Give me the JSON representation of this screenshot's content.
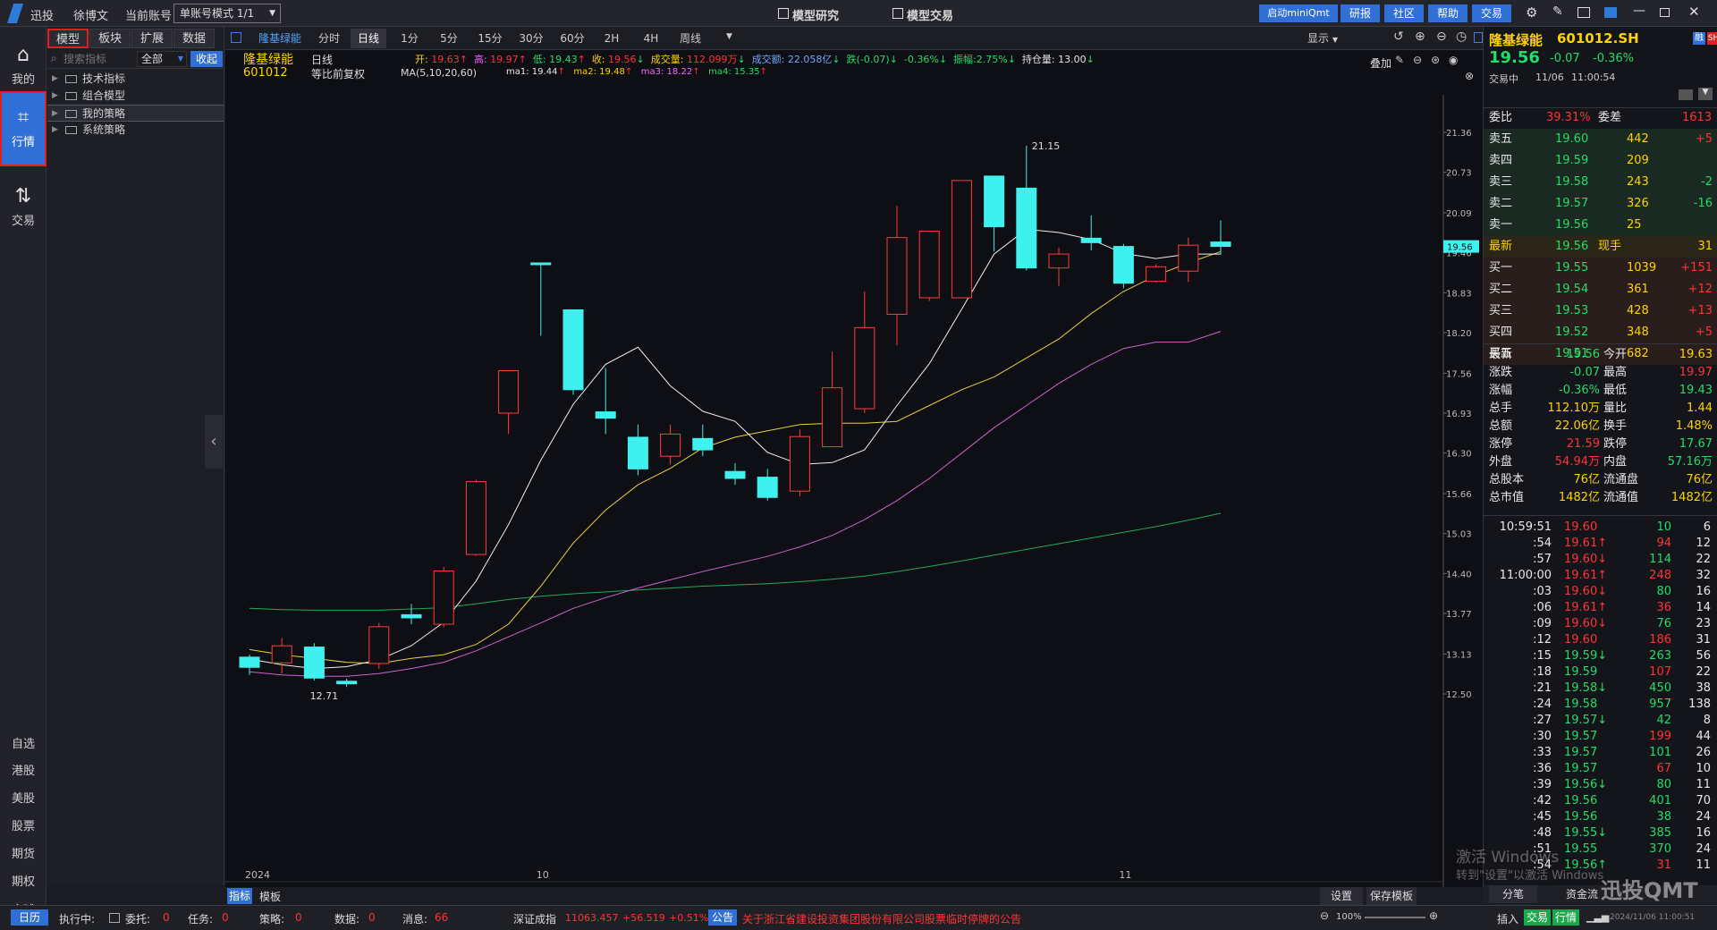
{
  "top": {
    "logo": "迅投",
    "user": "徐博文",
    "account_label": "当前账号",
    "account_mode": "单账号模式 1/1",
    "menu_research": "模型研究",
    "menu_trade": "模型交易",
    "btn_start_mini": "启动miniQmt",
    "btn_report": "研报",
    "btn_community": "社区",
    "btn_help": "帮助",
    "btn_trade": "交易"
  },
  "leftnav": {
    "mine": "我的",
    "quote": "行情",
    "trade": "交易",
    "bottom": [
      "自选",
      "港股",
      "美股",
      "股票",
      "期货",
      "期权",
      "全球"
    ]
  },
  "leftpanel": {
    "tabs": [
      "模型",
      "板块",
      "扩展",
      "数据"
    ],
    "search_placeholder": "搜索指标",
    "filter": "全部",
    "collapse": "收起",
    "tree": [
      "技术指标",
      "组合模型",
      "我的策略",
      "系统策略"
    ]
  },
  "chart_tabs": {
    "stock": "隆基绿能",
    "periods": [
      "分时",
      "日线",
      "1分",
      "5分",
      "15分",
      "30分",
      "60分",
      "2H",
      "4H",
      "周线"
    ],
    "display": "显示"
  },
  "info": {
    "name": "隆基绿能",
    "code": "601012",
    "period": "日线",
    "adjust": "等比前复权",
    "ma_label": "MA(5,10,20,60)",
    "open_l": "开:",
    "open": "19.63",
    "high_l": "高:",
    "high": "19.97",
    "low_l": "低:",
    "low": "19.43",
    "close_l": "收:",
    "close": "19.56",
    "vol_l": "成交量:",
    "vol": "112.099万",
    "amt_l": "成交额:",
    "amt": "22.058亿",
    "chg_l": "跌(-0.07)",
    "chgp": "-0.36%",
    "amp_l": "振幅:",
    "amp": "2.75%",
    "pos_l": "持仓量:",
    "pos": "13.00",
    "ma1_l": "ma1:",
    "ma1": "19.44",
    "ma2_l": "ma2:",
    "ma2": "19.48",
    "ma3_l": "ma3:",
    "ma3": "18.22",
    "ma4_l": "ma4:",
    "ma4": "15.35",
    "overlay": "叠加"
  },
  "chart_data": {
    "type": "candlestick",
    "y_ticks": [
      "21.36",
      "20.73",
      "20.09",
      "19.46",
      "18.83",
      "18.20",
      "17.56",
      "16.93",
      "16.30",
      "15.66",
      "15.03",
      "14.40",
      "13.77",
      "13.13",
      "12.50"
    ],
    "x_ticks": [
      "2024",
      "10",
      "11"
    ],
    "annotations": {
      "high": "21.15",
      "low": "12.71",
      "last_price_tag": "19.56"
    },
    "candles": [
      {
        "o": 13.08,
        "c": 12.92,
        "h": 13.12,
        "l": 12.8
      },
      {
        "o": 12.99,
        "c": 13.26,
        "h": 13.38,
        "l": 12.82
      },
      {
        "o": 13.24,
        "c": 12.75,
        "h": 13.3,
        "l": 12.71
      },
      {
        "o": 12.7,
        "c": 12.66,
        "h": 12.74,
        "l": 12.61
      },
      {
        "o": 12.98,
        "c": 13.56,
        "h": 13.62,
        "l": 12.9
      },
      {
        "o": 13.75,
        "c": 13.7,
        "h": 13.92,
        "l": 13.6
      },
      {
        "o": 13.6,
        "c": 14.44,
        "h": 14.5,
        "l": 13.55
      },
      {
        "o": 14.7,
        "c": 15.85,
        "h": 15.88,
        "l": 14.68
      },
      {
        "o": 16.93,
        "c": 17.6,
        "h": 17.6,
        "l": 16.6
      },
      {
        "o": 19.3,
        "c": 19.28,
        "h": 19.3,
        "l": 18.15
      },
      {
        "o": 18.56,
        "c": 17.3,
        "h": 18.56,
        "l": 17.22
      },
      {
        "o": 16.95,
        "c": 16.85,
        "h": 17.64,
        "l": 16.6
      },
      {
        "o": 16.55,
        "c": 16.05,
        "h": 16.75,
        "l": 15.95
      },
      {
        "o": 16.25,
        "c": 16.6,
        "h": 16.75,
        "l": 16.12
      },
      {
        "o": 16.53,
        "c": 16.35,
        "h": 16.75,
        "l": 16.25
      },
      {
        "o": 16.01,
        "c": 15.9,
        "h": 16.14,
        "l": 15.8
      },
      {
        "o": 15.92,
        "c": 15.6,
        "h": 16.05,
        "l": 15.55
      },
      {
        "o": 15.7,
        "c": 16.56,
        "h": 16.67,
        "l": 15.62
      },
      {
        "o": 16.4,
        "c": 17.33,
        "h": 17.9,
        "l": 16.4
      },
      {
        "o": 17.0,
        "c": 18.28,
        "h": 18.85,
        "l": 16.93
      },
      {
        "o": 18.49,
        "c": 19.7,
        "h": 20.2,
        "l": 18.0
      },
      {
        "o": 18.75,
        "c": 19.8,
        "h": 19.8,
        "l": 18.7
      },
      {
        "o": 18.75,
        "c": 20.6,
        "h": 20.6,
        "l": 18.75
      },
      {
        "o": 20.67,
        "c": 19.87,
        "h": 20.67,
        "l": 19.48
      },
      {
        "o": 20.48,
        "c": 19.22,
        "h": 21.15,
        "l": 19.18
      },
      {
        "o": 19.22,
        "c": 19.44,
        "h": 19.54,
        "l": 18.94
      },
      {
        "o": 19.69,
        "c": 19.62,
        "h": 20.05,
        "l": 19.5
      },
      {
        "o": 19.56,
        "c": 18.98,
        "h": 19.6,
        "l": 18.9
      },
      {
        "o": 19.01,
        "c": 19.24,
        "h": 19.28,
        "l": 18.99
      },
      {
        "o": 19.17,
        "c": 19.58,
        "h": 19.7,
        "l": 19.0
      },
      {
        "o": 19.63,
        "c": 19.56,
        "h": 19.97,
        "l": 19.43
      }
    ],
    "ma1": [
      13.05,
      12.96,
      12.9,
      12.93,
      13.04,
      13.26,
      13.63,
      14.28,
      15.17,
      16.19,
      17.07,
      17.7,
      17.97,
      17.36,
      16.96,
      16.8,
      16.31,
      16.12,
      16.15,
      16.35,
      17.05,
      17.71,
      18.57,
      19.44,
      19.83,
      19.78,
      19.67,
      19.45,
      19.37,
      19.44,
      19.44
    ],
    "ma2": [
      13.2,
      13.12,
      13.06,
      13.0,
      12.98,
      13.06,
      13.12,
      13.28,
      13.6,
      14.2,
      14.88,
      15.4,
      15.8,
      16.06,
      16.38,
      16.55,
      16.65,
      16.75,
      16.77,
      16.77,
      16.8,
      17.05,
      17.3,
      17.5,
      17.8,
      18.1,
      18.5,
      18.85,
      19.1,
      19.3,
      19.48
    ],
    "ma3": [
      12.85,
      12.8,
      12.78,
      12.78,
      12.82,
      12.9,
      13.0,
      13.18,
      13.4,
      13.62,
      13.85,
      14.02,
      14.17,
      14.3,
      14.43,
      14.55,
      14.67,
      14.82,
      15.0,
      15.25,
      15.55,
      15.9,
      16.3,
      16.7,
      17.05,
      17.4,
      17.7,
      17.95,
      18.05,
      18.05,
      18.22
    ],
    "ma4": [
      13.85,
      13.83,
      13.82,
      13.82,
      13.82,
      13.84,
      13.86,
      13.92,
      13.99,
      14.04,
      14.08,
      14.11,
      14.14,
      14.17,
      14.2,
      14.22,
      14.24,
      14.27,
      14.31,
      14.36,
      14.43,
      14.51,
      14.6,
      14.69,
      14.78,
      14.87,
      14.96,
      15.05,
      15.14,
      15.24,
      15.35
    ]
  },
  "right": {
    "name": "隆基绿能",
    "code": "601012.SH",
    "price": "19.56",
    "chg": "-0.07",
    "chgp": "-0.36%",
    "status": "交易中",
    "date": "11/06",
    "time": "11:00:54",
    "wb_l": "委比",
    "wb": "39.31%",
    "wc_l": "委差",
    "wc": "1613",
    "asks": [
      {
        "l": "卖五",
        "p": "19.60",
        "v": "442",
        "d": "+5"
      },
      {
        "l": "卖四",
        "p": "19.59",
        "v": "209",
        "d": ""
      },
      {
        "l": "卖三",
        "p": "19.58",
        "v": "243",
        "d": "-2"
      },
      {
        "l": "卖二",
        "p": "19.57",
        "v": "326",
        "d": "-16"
      },
      {
        "l": "卖一",
        "p": "19.56",
        "v": "25",
        "d": ""
      }
    ],
    "latest": {
      "l": "最新",
      "p": "19.56",
      "v": "现手",
      "d": "31"
    },
    "bids": [
      {
        "l": "买一",
        "p": "19.55",
        "v": "1039",
        "d": "+151"
      },
      {
        "l": "买二",
        "p": "19.54",
        "v": "361",
        "d": "+12"
      },
      {
        "l": "买三",
        "p": "19.53",
        "v": "428",
        "d": "+13"
      },
      {
        "l": "买四",
        "p": "19.52",
        "v": "348",
        "d": "+5"
      },
      {
        "l": "买五",
        "p": "19.51",
        "v": "682",
        "d": ""
      }
    ],
    "stats": [
      [
        "最新",
        "19.56",
        "今开",
        "19.63"
      ],
      [
        "涨跌",
        "-0.07",
        "最高",
        "19.97"
      ],
      [
        "涨幅",
        "-0.36%",
        "最低",
        "19.43"
      ],
      [
        "总手",
        "112.10万",
        "量比",
        "1.44"
      ],
      [
        "总额",
        "22.06亿",
        "换手",
        "1.48%"
      ],
      [
        "涨停",
        "21.59",
        "跌停",
        "17.67"
      ],
      [
        "外盘",
        "54.94万",
        "内盘",
        "57.16万"
      ],
      [
        "总股本",
        "76亿",
        "流通盘",
        "76亿"
      ],
      [
        "总市值",
        "1482亿",
        "流通值",
        "1482亿"
      ]
    ],
    "ticks": [
      [
        "10:59:51",
        "19.60",
        "10",
        "6"
      ],
      [
        ":54",
        "19.61↑",
        "94",
        "12"
      ],
      [
        ":57",
        "19.60↓",
        "114",
        "22"
      ],
      [
        "11:00:00",
        "19.61↑",
        "248",
        "32"
      ],
      [
        ":03",
        "19.60↓",
        "80",
        "16"
      ],
      [
        ":06",
        "19.61↑",
        "36",
        "14"
      ],
      [
        ":09",
        "19.60↓",
        "76",
        "23"
      ],
      [
        ":12",
        "19.60",
        "186",
        "31"
      ],
      [
        ":15",
        "19.59↓",
        "263",
        "56"
      ],
      [
        ":18",
        "19.59",
        "107",
        "22"
      ],
      [
        ":21",
        "19.58↓",
        "450",
        "38"
      ],
      [
        ":24",
        "19.58",
        "957",
        "138"
      ],
      [
        ":27",
        "19.57↓",
        "42",
        "8"
      ],
      [
        ":30",
        "19.57",
        "199",
        "44"
      ],
      [
        ":33",
        "19.57",
        "101",
        "26"
      ],
      [
        ":36",
        "19.57",
        "67",
        "10"
      ],
      [
        ":39",
        "19.56↓",
        "80",
        "11"
      ],
      [
        ":42",
        "19.56",
        "401",
        "70"
      ],
      [
        ":45",
        "19.56",
        "38",
        "24"
      ],
      [
        ":48",
        "19.55↓",
        "385",
        "16"
      ],
      [
        ":51",
        "19.55",
        "370",
        "24"
      ],
      [
        ":54",
        "19.56↑",
        "31",
        "11"
      ]
    ],
    "tabs": [
      "分笔",
      "资金流"
    ]
  },
  "sub": {
    "indicator": "指标",
    "template": "模板",
    "settings": "设置",
    "save_template": "保存模板"
  },
  "status": {
    "calendar": "日历",
    "exec": "执行中:",
    "entrust": "委托:",
    "entrust_v": "0",
    "task": "任务:",
    "task_v": "0",
    "strategy": "策略:",
    "strategy_v": "0",
    "data": "数据:",
    "data_v": "0",
    "msg": "消息:",
    "msg_v": "66",
    "index": "深证成指",
    "index_v": "11063.457",
    "index_chg": "+56.519",
    "index_pct": "+0.51%",
    "notice_tag": "公告",
    "notice": "关于浙江省建设投资集团股份有限公司股票临时停牌的公告",
    "zoom": "100%",
    "insert": "插入",
    "trade": "交易",
    "quote": "行情",
    "watermark1": "激活 Windows",
    "watermark2": "转到\"设置\"以激活 Windows",
    "brand": "迅投QMT",
    "clock": "2024/11/06 11:00:51"
  }
}
